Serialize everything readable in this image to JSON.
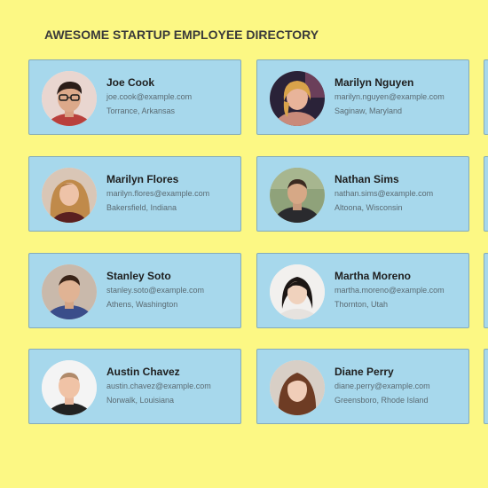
{
  "page": {
    "title": "AWESOME STARTUP EMPLOYEE DIRECTORY"
  },
  "employees": [
    {
      "name": "Joe Cook",
      "email": "joe.cook@example.com",
      "location": "Torrance, Arkansas"
    },
    {
      "name": "Marilyn Nguyen",
      "email": "marilyn.nguyen@example.com",
      "location": "Saginaw, Maryland"
    },
    {
      "name": "Marilyn Flores",
      "email": "marilyn.flores@example.com",
      "location": "Bakersfield, Indiana"
    },
    {
      "name": "Nathan Sims",
      "email": "nathan.sims@example.com",
      "location": "Altoona, Wisconsin"
    },
    {
      "name": "Stanley Soto",
      "email": "stanley.soto@example.com",
      "location": "Athens, Washington"
    },
    {
      "name": "Martha Moreno",
      "email": "martha.moreno@example.com",
      "location": "Thornton, Utah"
    },
    {
      "name": "Austin Chavez",
      "email": "austin.chavez@example.com",
      "location": "Norwalk, Louisiana"
    },
    {
      "name": "Diane Perry",
      "email": "diane.perry@example.com",
      "location": "Greensboro, Rhode Island"
    }
  ],
  "colors": {
    "background": "#fcf884",
    "card": "#a7d8ec",
    "card_border": "#85acb9"
  }
}
